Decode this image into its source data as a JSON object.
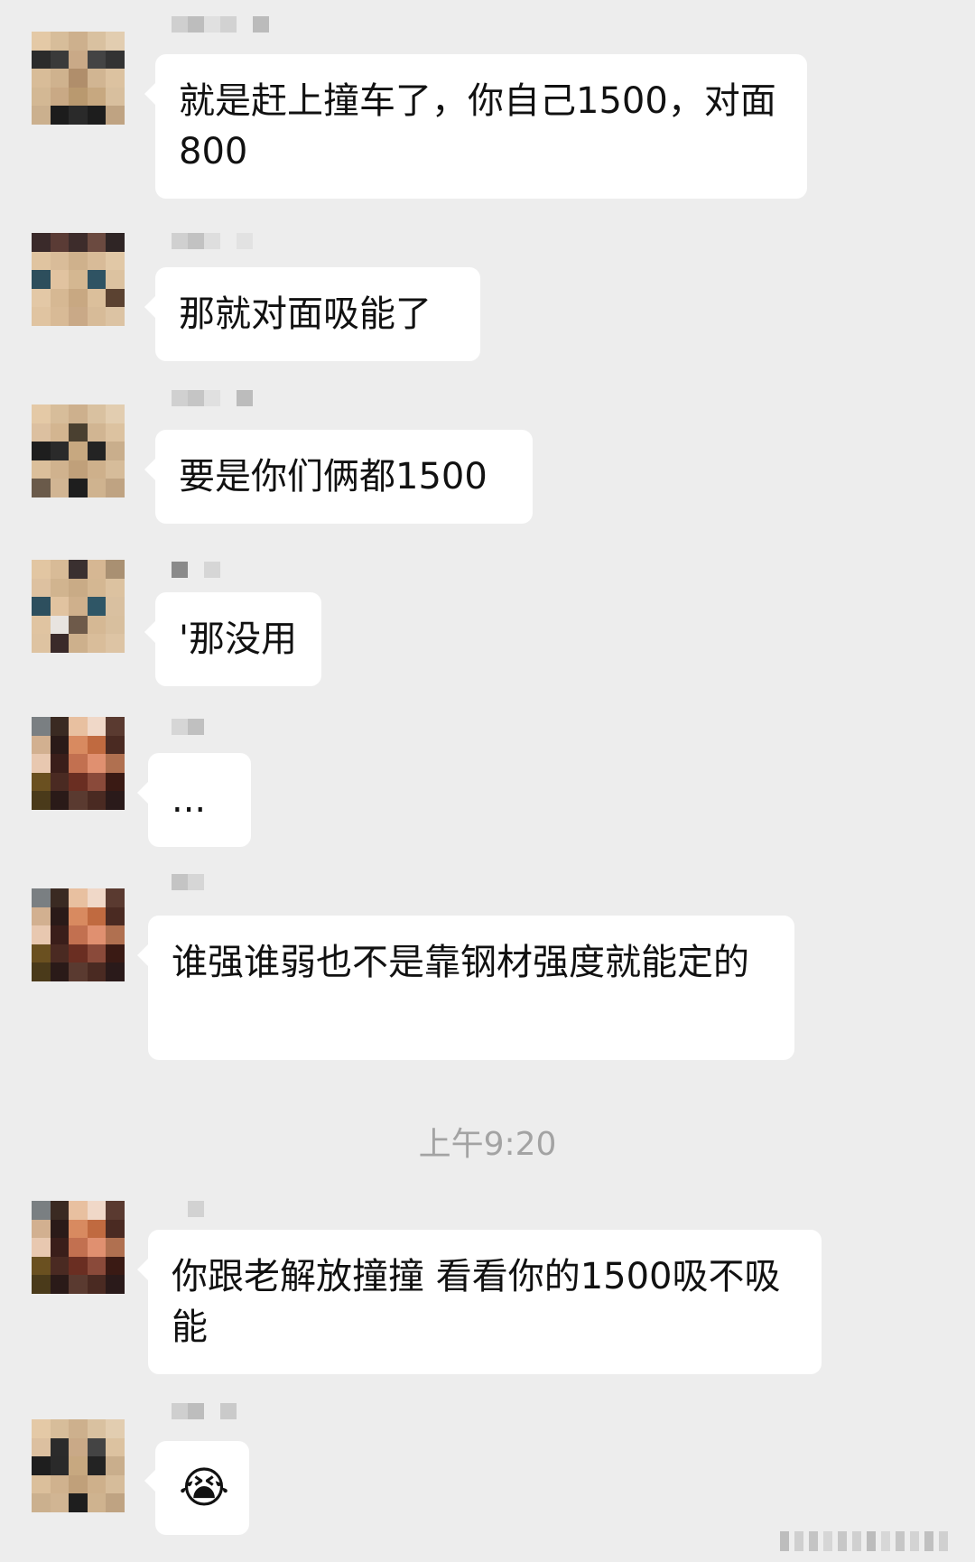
{
  "messages": [
    {
      "text": "就是赶上撞车了，你自己1500，对面800"
    },
    {
      "text": "那就对面吸能了"
    },
    {
      "text": "要是你们俩都1500"
    },
    {
      "text": "'那没用"
    },
    {
      "text": "..."
    },
    {
      "text": "谁强谁弱也不是靠钢材强度就能定的"
    },
    {
      "text": "你跟老解放撞撞 看看你的1500吸不吸能"
    },
    {
      "text": "😭"
    }
  ],
  "timestamp": "上午9:20",
  "colors": {
    "background": "#ededed",
    "bubble": "#ffffff",
    "text": "#111111",
    "timestamp": "#a3a3a3"
  },
  "icons": {
    "avatar": "pixelated-avatar-icon",
    "emoji": "crying-face-icon"
  }
}
